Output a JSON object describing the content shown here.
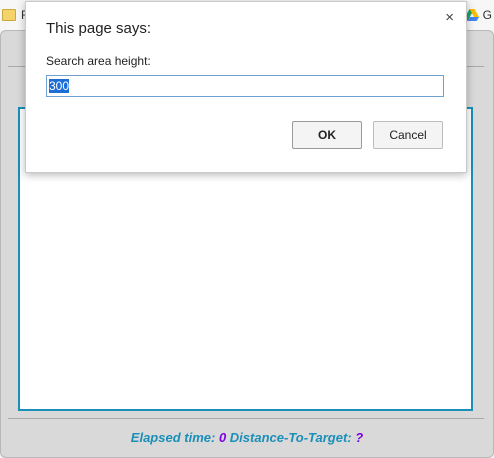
{
  "bookmarks": {
    "left_item": "F",
    "right_item": "G"
  },
  "dialog": {
    "title": "This page says:",
    "close_glyph": "×",
    "prompt": "Search area height:",
    "input_value": "300",
    "ok_label": "OK",
    "cancel_label": "Cancel"
  },
  "status": {
    "elapsed_label": "Elapsed time:",
    "elapsed_value": "0",
    "distance_label": "Distance-To-Target:",
    "distance_value": "?"
  },
  "colors": {
    "search_area_border": "#1a8fb8",
    "status_label": "#1a8fb8",
    "status_value": "#7a00e0",
    "input_selection": "#1c6ed6"
  },
  "icons": {
    "bookmark_left": "folder-icon",
    "bookmark_right": "google-drive-icon",
    "dialog_close": "close-icon"
  }
}
